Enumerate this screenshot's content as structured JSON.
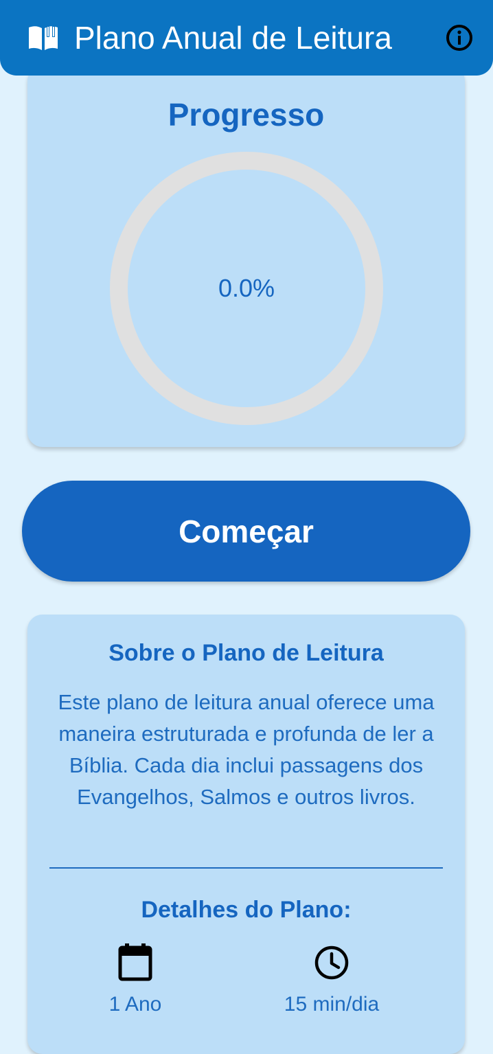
{
  "app_bar": {
    "title": "Plano Anual de Leitura",
    "leading_icon": "book-open-icon",
    "trailing_icon": "info-icon"
  },
  "progress": {
    "heading": "Progresso",
    "percent_text": "0.0%",
    "value": 0.0
  },
  "start_button": {
    "label": "Começar"
  },
  "about": {
    "title": "Sobre o Plano de Leitura",
    "description": "Este plano de leitura anual oferece uma maneira estruturada e profunda de ler a Bíblia. Cada dia inclui passagens dos Evangelhos, Salmos e outros livros."
  },
  "details": {
    "title": "Detalhes do Plano:",
    "items": [
      {
        "icon": "calendar-icon",
        "label": "1 Ano"
      },
      {
        "icon": "clock-icon",
        "label": "15 min/dia"
      }
    ]
  },
  "colors": {
    "app_bar": "#0b74c2",
    "background": "#e0f2fd",
    "card": "#bcdef8",
    "primary": "#1565c0",
    "ring_track": "#e0e0e0"
  }
}
